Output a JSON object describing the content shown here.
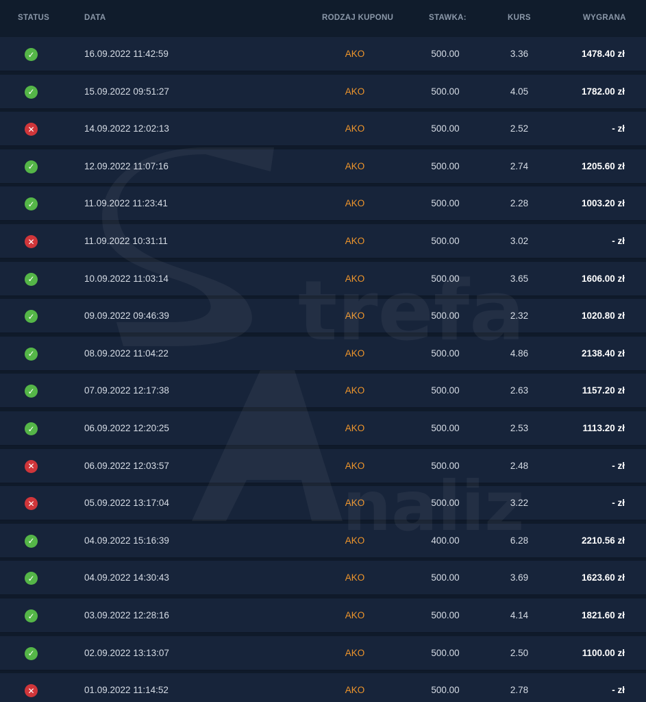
{
  "header": {
    "status": "STATUS",
    "date": "DATA",
    "coupon_type": "RODZAJ KUPONU",
    "stake": "STAWKA:",
    "odds": "KURS",
    "win": "WYGRANA"
  },
  "watermark": {
    "line1": "trefa",
    "line2": "naliz"
  },
  "colors": {
    "background": "#0f1a2a",
    "row": "#17243a",
    "accent": "#f0962b",
    "success": "#55b648",
    "fail": "#d0363a"
  },
  "rows": [
    {
      "status": "won",
      "date": "16.09.2022 11:42:59",
      "type": "AKO",
      "stake": "500.00",
      "odds": "3.36",
      "win": "1478.40 zł"
    },
    {
      "status": "won",
      "date": "15.09.2022 09:51:27",
      "type": "AKO",
      "stake": "500.00",
      "odds": "4.05",
      "win": "1782.00 zł"
    },
    {
      "status": "lost",
      "date": "14.09.2022 12:02:13",
      "type": "AKO",
      "stake": "500.00",
      "odds": "2.52",
      "win": "- zł"
    },
    {
      "status": "won",
      "date": "12.09.2022 11:07:16",
      "type": "AKO",
      "stake": "500.00",
      "odds": "2.74",
      "win": "1205.60 zł"
    },
    {
      "status": "won",
      "date": "11.09.2022 11:23:41",
      "type": "AKO",
      "stake": "500.00",
      "odds": "2.28",
      "win": "1003.20 zł"
    },
    {
      "status": "lost",
      "date": "11.09.2022 10:31:11",
      "type": "AKO",
      "stake": "500.00",
      "odds": "3.02",
      "win": "- zł"
    },
    {
      "status": "won",
      "date": "10.09.2022 11:03:14",
      "type": "AKO",
      "stake": "500.00",
      "odds": "3.65",
      "win": "1606.00 zł"
    },
    {
      "status": "won",
      "date": "09.09.2022 09:46:39",
      "type": "AKO",
      "stake": "500.00",
      "odds": "2.32",
      "win": "1020.80 zł"
    },
    {
      "status": "won",
      "date": "08.09.2022 11:04:22",
      "type": "AKO",
      "stake": "500.00",
      "odds": "4.86",
      "win": "2138.40 zł"
    },
    {
      "status": "won",
      "date": "07.09.2022 12:17:38",
      "type": "AKO",
      "stake": "500.00",
      "odds": "2.63",
      "win": "1157.20 zł"
    },
    {
      "status": "won",
      "date": "06.09.2022 12:20:25",
      "type": "AKO",
      "stake": "500.00",
      "odds": "2.53",
      "win": "1113.20 zł"
    },
    {
      "status": "lost",
      "date": "06.09.2022 12:03:57",
      "type": "AKO",
      "stake": "500.00",
      "odds": "2.48",
      "win": "- zł"
    },
    {
      "status": "lost",
      "date": "05.09.2022 13:17:04",
      "type": "AKO",
      "stake": "500.00",
      "odds": "3.22",
      "win": "- zł"
    },
    {
      "status": "won",
      "date": "04.09.2022 15:16:39",
      "type": "AKO",
      "stake": "400.00",
      "odds": "6.28",
      "win": "2210.56 zł"
    },
    {
      "status": "won",
      "date": "04.09.2022 14:30:43",
      "type": "AKO",
      "stake": "500.00",
      "odds": "3.69",
      "win": "1623.60 zł"
    },
    {
      "status": "won",
      "date": "03.09.2022 12:28:16",
      "type": "AKO",
      "stake": "500.00",
      "odds": "4.14",
      "win": "1821.60 zł"
    },
    {
      "status": "won",
      "date": "02.09.2022 13:13:07",
      "type": "AKO",
      "stake": "500.00",
      "odds": "2.50",
      "win": "1100.00 zł"
    },
    {
      "status": "lost",
      "date": "01.09.2022 11:14:52",
      "type": "AKO",
      "stake": "500.00",
      "odds": "2.78",
      "win": "- zł"
    }
  ]
}
